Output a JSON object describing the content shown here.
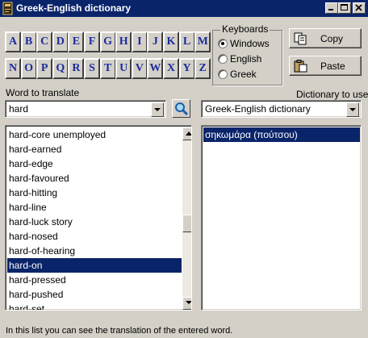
{
  "window": {
    "title": "Greek-English dictionary",
    "caption_buttons": [
      "minimize",
      "maximize",
      "close"
    ]
  },
  "letters": [
    "A",
    "B",
    "C",
    "D",
    "E",
    "F",
    "G",
    "H",
    "I",
    "J",
    "K",
    "L",
    "M",
    "N",
    "O",
    "P",
    "Q",
    "R",
    "S",
    "T",
    "U",
    "V",
    "W",
    "X",
    "Y",
    "Z"
  ],
  "keyboards": {
    "legend": "Keyboards",
    "options": [
      {
        "label": "Windows",
        "checked": true
      },
      {
        "label": "English",
        "checked": false
      },
      {
        "label": "Greek",
        "checked": false
      }
    ]
  },
  "actions": {
    "copy_label": "Copy",
    "paste_label": "Paste"
  },
  "word_input": {
    "label": "Word to translate",
    "value": "hard"
  },
  "dictionary": {
    "label": "Dictionary to use",
    "selected": "Greek-English dictionary"
  },
  "word_list": {
    "items": [
      "hard-core unemployed",
      "hard-earned",
      "hard-edge",
      "hard-favoured",
      "hard-hitting",
      "hard-line",
      "hard-luck story",
      "hard-nosed",
      "hard-of-hearing",
      "hard-on",
      "hard-pressed",
      "hard-pushed",
      "hard-set"
    ],
    "selected_index": 9
  },
  "translation_list": {
    "items": [
      "σηκωμάρα (πούτσου)"
    ],
    "selected_index": 0
  },
  "status": {
    "text": "In this list you can see the translation of the entered word."
  },
  "icons": {
    "app": "dictionary-book-icon",
    "search": "magnifier-icon",
    "copy": "copy-icon",
    "paste": "paste-clipboard-icon"
  },
  "colors": {
    "face": "#d4d0c8",
    "titlebar": "#0a246a",
    "selection": "#0a246a",
    "letter_text": "#1a2c9c"
  }
}
